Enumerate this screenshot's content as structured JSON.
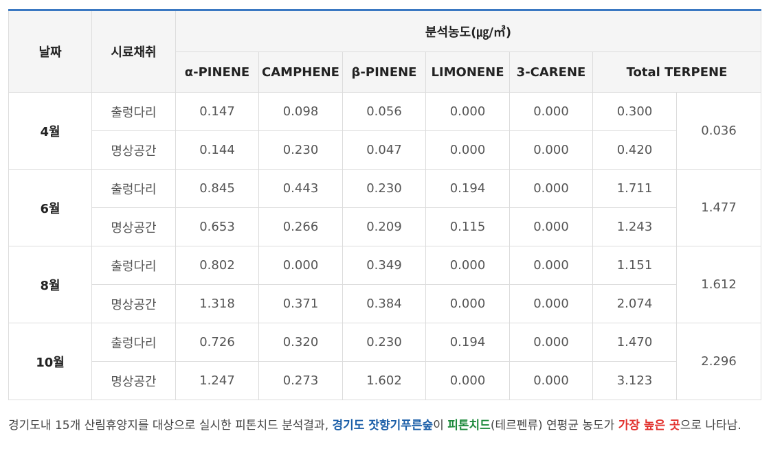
{
  "table": {
    "headers": {
      "date": "날짜",
      "site": "시료채취",
      "group": "분석농도(㎍/㎥)",
      "compounds": [
        "α-PINENE",
        "CAMPHENE",
        "β-PINENE",
        "LIMONENE",
        "3-CARENE",
        "Total TERPENE"
      ]
    },
    "months": [
      {
        "label": "4월",
        "rows": [
          {
            "site": "출렁다리",
            "values": [
              "0.147",
              "0.098",
              "0.056",
              "0.000",
              "0.000",
              "0.300"
            ]
          },
          {
            "site": "명상공간",
            "values": [
              "0.144",
              "0.230",
              "0.047",
              "0.000",
              "0.000",
              "0.420"
            ]
          }
        ],
        "extra": "0.036"
      },
      {
        "label": "6월",
        "rows": [
          {
            "site": "출렁다리",
            "values": [
              "0.845",
              "0.443",
              "0.230",
              "0.194",
              "0.000",
              "1.711"
            ]
          },
          {
            "site": "명상공간",
            "values": [
              "0.653",
              "0.266",
              "0.209",
              "0.115",
              "0.000",
              "1.243"
            ]
          }
        ],
        "extra": "1.477"
      },
      {
        "label": "8월",
        "rows": [
          {
            "site": "출렁다리",
            "values": [
              "0.802",
              "0.000",
              "0.349",
              "0.000",
              "0.000",
              "1.151"
            ]
          },
          {
            "site": "명상공간",
            "values": [
              "1.318",
              "0.371",
              "0.384",
              "0.000",
              "0.000",
              "2.074"
            ]
          }
        ],
        "extra": "1.612"
      },
      {
        "label": "10월",
        "rows": [
          {
            "site": "출렁다리",
            "values": [
              "0.726",
              "0.320",
              "0.230",
              "0.194",
              "0.000",
              "1.470"
            ]
          },
          {
            "site": "명상공간",
            "values": [
              "1.247",
              "0.273",
              "1.602",
              "0.000",
              "0.000",
              "3.123"
            ]
          }
        ],
        "extra": "2.296"
      }
    ]
  },
  "caption": {
    "part1": "경기도내 15개 산림휴양지를 대상으로 실시한 피톤치드 분석결과, ",
    "highlight_place": "경기도 잣향기푸른숲",
    "part2": "이 ",
    "highlight_subject": "피톤치드",
    "part3": "(테르펜류) 연평균 농도가 ",
    "highlight_result": "가장 높은 곳",
    "part4": "으로 나타남."
  },
  "colors": {
    "accent_border": "#3a78c2",
    "highlight_blue": "#1a5ea8",
    "highlight_green": "#1e8a3c",
    "highlight_red": "#e2322e"
  }
}
